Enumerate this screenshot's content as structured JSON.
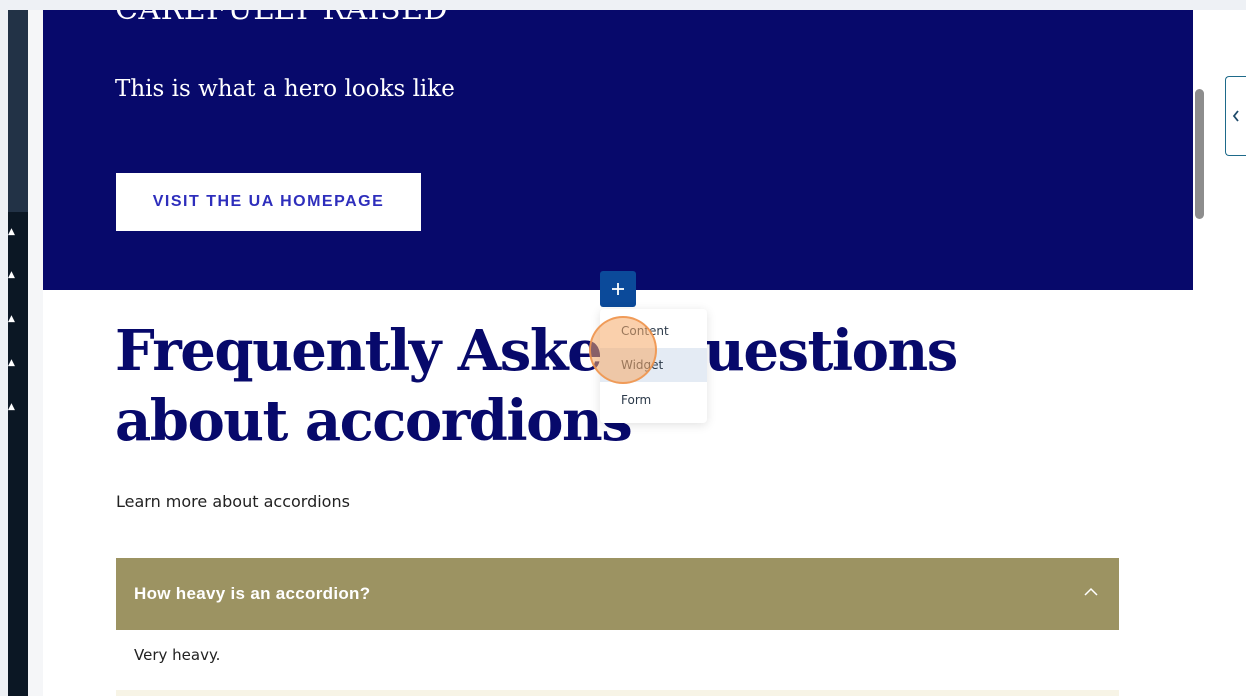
{
  "hero": {
    "title": "CAREFULLY RAISED",
    "subtitle": "This is what a hero looks like",
    "button_label": "VISIT THE UA HOMEPAGE",
    "background_color": "#07096b"
  },
  "faq": {
    "heading": "Frequently Asked Questions about accordions",
    "intro": "Learn more about accordions",
    "accordion": {
      "question": "How heavy is an accordion?",
      "answer": "Very heavy.",
      "expanded": true,
      "header_color": "#9c9362"
    }
  },
  "add_menu": {
    "button_icon": "plus-icon",
    "items": [
      {
        "label": "Content",
        "selected": false
      },
      {
        "label": "Widget",
        "selected": true
      },
      {
        "label": "Form",
        "selected": false
      }
    ]
  },
  "sidebar": {
    "arrow_icon": "caret-up-icon",
    "arrow_count": 5
  },
  "right_panel": {
    "toggle_icon": "chevron-left-icon"
  },
  "colors": {
    "accent_blue": "#0b4a9a",
    "heading_navy": "#07096b",
    "click_highlight": "#f6aa68"
  }
}
